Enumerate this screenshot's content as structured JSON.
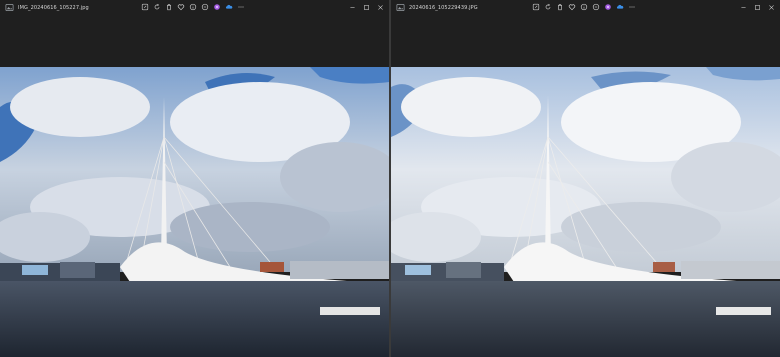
{
  "windows": [
    {
      "file_name": "IMG_20240616_105227.jpg",
      "toolbar_icons": [
        "edit-icon",
        "rotate-icon",
        "delete-icon",
        "favorite-icon",
        "info-icon",
        "compare-icon",
        "copilot-icon",
        "onedrive-icon",
        "more-icon"
      ],
      "controls": [
        "minimize-icon",
        "maximize-icon",
        "close-icon"
      ],
      "photo": {
        "variant": "saturated"
      }
    },
    {
      "file_name": "20240616_105229439.JPG",
      "toolbar_icons": [
        "edit-icon",
        "rotate-icon",
        "delete-icon",
        "favorite-icon",
        "info-icon",
        "compare-icon",
        "copilot-icon",
        "onedrive-icon",
        "more-icon"
      ],
      "controls": [
        "minimize-icon",
        "maximize-icon",
        "close-icon"
      ],
      "photo": {
        "variant": "bright"
      }
    }
  ],
  "colors": {
    "titlebar_bg": "#1f1f1f",
    "accent_copilot": "#a35ce0",
    "accent_onedrive": "#3a8ee6"
  }
}
